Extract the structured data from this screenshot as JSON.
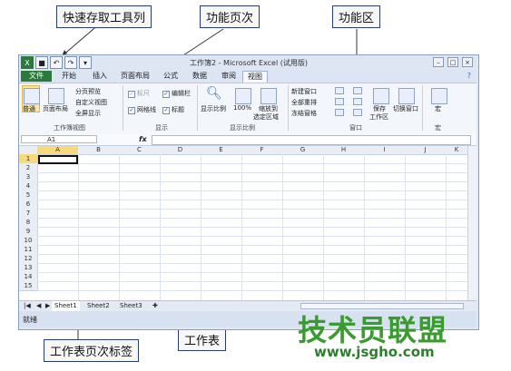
{
  "callouts": {
    "quick_access_toolbar": "快速存取工具列",
    "ribbon_tabs": "功能页次",
    "ribbon": "功能区",
    "sheet_tabs": "工作表页次标签",
    "worksheet": "工作表"
  },
  "window": {
    "title": "工作簿2 - Microsoft Excel (试用版)",
    "qat_icons": [
      "excel-icon",
      "save-icon",
      "undo-icon",
      "redo-icon",
      "customize-icon"
    ]
  },
  "tabs": [
    {
      "label": "文件"
    },
    {
      "label": "开始"
    },
    {
      "label": "插入"
    },
    {
      "label": "页面布局"
    },
    {
      "label": "公式"
    },
    {
      "label": "数据"
    },
    {
      "label": "审阅"
    },
    {
      "label": "视图"
    }
  ],
  "ribbon": {
    "workbook_views": {
      "normal": "普通",
      "page_layout": "页面布局",
      "page_break": "分页预览",
      "custom_views": "自定义视图",
      "full_screen": "全屏显示",
      "group": "工作簿视图"
    },
    "show": {
      "ruler": "标尺",
      "formula_bar": "编辑栏",
      "gridlines": "网格线",
      "headings": "标题",
      "group": "显示"
    },
    "zoom": {
      "zoom": "显示比例",
      "hundred": "100%",
      "zoom_selection": "缩放到",
      "zoom_selection2": "选定区域",
      "group": "显示比例"
    },
    "window": {
      "new_window": "新建窗口",
      "arrange_all": "全部重排",
      "freeze_panes": "冻结窗格",
      "save_workspace": "保存",
      "save_workspace2": "工作区",
      "switch_windows": "切换窗口",
      "group": "窗口"
    },
    "macros": {
      "macros": "宏",
      "group": "宏"
    }
  },
  "formula_bar": {
    "name_box": "A1",
    "fx": "fx"
  },
  "grid": {
    "columns": [
      "A",
      "B",
      "C",
      "D",
      "E",
      "F",
      "G",
      "H",
      "I",
      "J",
      "K"
    ],
    "rows": [
      "1",
      "2",
      "3",
      "4",
      "5",
      "6",
      "7",
      "8",
      "9",
      "10",
      "11",
      "12",
      "13",
      "14",
      "15"
    ]
  },
  "sheets": [
    "Sheet1",
    "Sheet2",
    "Sheet3"
  ],
  "status": {
    "ready": "就绪"
  },
  "watermark": {
    "text": "技术员联盟",
    "url": "www.jsgho.com"
  }
}
